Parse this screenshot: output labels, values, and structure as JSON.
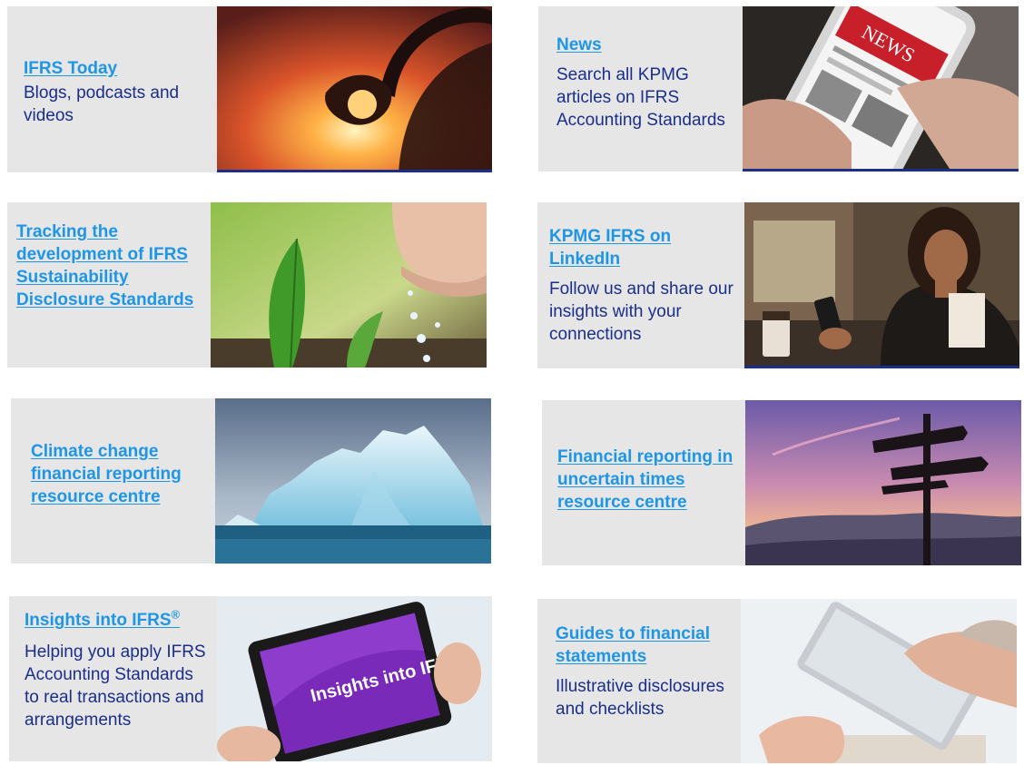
{
  "cards": [
    {
      "title": "IFRS Today",
      "description": "Blogs, podcasts and videos",
      "image": "headphones-sunset-image"
    },
    {
      "title": "News",
      "description": "Search all KPMG articles on IFRS Accounting Standards",
      "image": "news-phone-image"
    },
    {
      "title": "Tracking the development of IFRS Sustainability Disclosure Standards",
      "description": "",
      "image": "water-leaf-image"
    },
    {
      "title": "KPMG IFRS on LinkedIn",
      "description": "Follow us and share our insights with your connections",
      "image": "woman-phone-cafe-image"
    },
    {
      "title": "Climate change financial reporting resource centre",
      "description": "",
      "image": "iceberg-image"
    },
    {
      "title": "Financial reporting in uncertain times resource centre",
      "description": "",
      "image": "signpost-sunset-image"
    },
    {
      "title": "Insights into IFRS",
      "title_sup": "®",
      "description": "Helping you apply IFRS Accounting Standards to real transactions and arrangements",
      "image": "tablet-insights-image",
      "image_text": "Insights into IFRS"
    },
    {
      "title": "Guides to financial statements",
      "description": "Illustrative disclosures and checklists",
      "image": "hands-tablet-image"
    }
  ],
  "colors": {
    "link": "#1e96e6",
    "text": "#1a2e8a",
    "panel": "#e6e6e6"
  }
}
